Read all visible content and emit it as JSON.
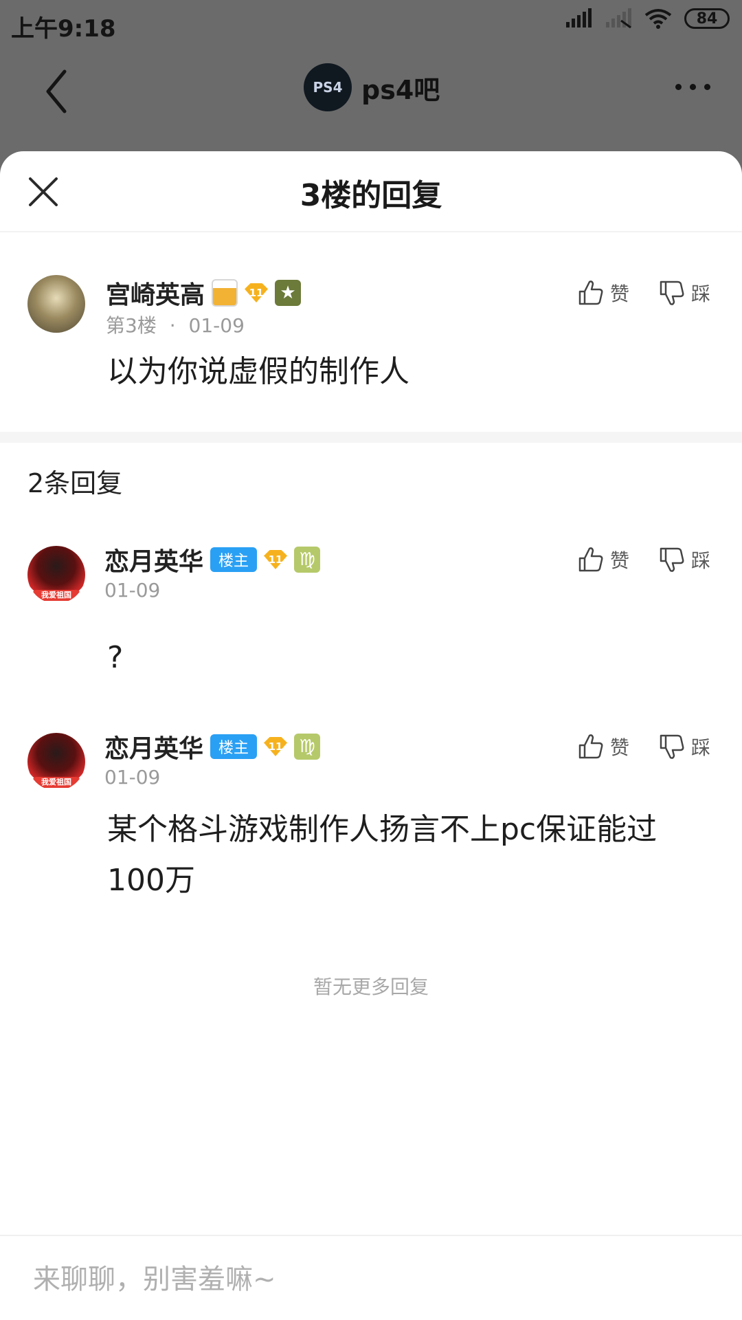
{
  "status_bar": {
    "time": "上午9:18",
    "battery": "84"
  },
  "topbar": {
    "forum_name": "ps4吧",
    "forum_logo_text": "PS4"
  },
  "sheet": {
    "title": "3楼的回复"
  },
  "main_post": {
    "username": "宫崎英高",
    "level": "11",
    "meta_floor": "第3楼",
    "meta_sep": "·",
    "meta_date": "01-09",
    "content": "以为你说虚假的制作人"
  },
  "actions": {
    "like_label": "赞",
    "dislike_label": "踩"
  },
  "replies_header": {
    "count_text": "2条回复"
  },
  "replies": [
    {
      "username": "恋月英华",
      "host_badge": "楼主",
      "level": "11",
      "zodiac": "♍",
      "avatar_tag": "我爱祖国",
      "date": "01-09",
      "content": "?"
    },
    {
      "username": "恋月英华",
      "host_badge": "楼主",
      "level": "11",
      "zodiac": "♍",
      "avatar_tag": "我爱祖国",
      "date": "01-09",
      "content": "某个格斗游戏制作人扬言不上pc保证能过100万"
    }
  ],
  "no_more_text": "暂无更多回复",
  "input": {
    "placeholder": "来聊聊，别害羞嘛~"
  },
  "colors": {
    "overlay": "#6b6b6b",
    "host_badge": "#2aa0f4",
    "level_badge": "#f6b21e",
    "text_primary": "#1e1e1e",
    "text_secondary": "#9a9a9a"
  }
}
